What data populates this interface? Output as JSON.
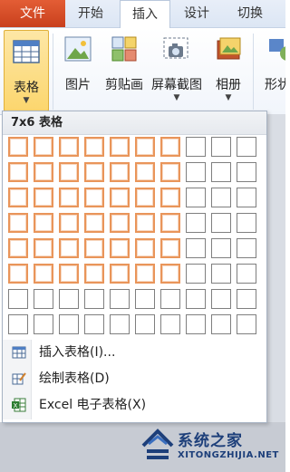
{
  "tabs": [
    {
      "label": "文件"
    },
    {
      "label": "开始"
    },
    {
      "label": "插入"
    },
    {
      "label": "设计"
    },
    {
      "label": "切换"
    }
  ],
  "ribbon": {
    "buttons": [
      {
        "label": "表格",
        "icon": "table-icon"
      },
      {
        "label": "图片",
        "icon": "picture-icon"
      },
      {
        "label": "剪贴画",
        "icon": "clipart-icon"
      },
      {
        "label": "屏幕截图",
        "icon": "screenshot-icon"
      },
      {
        "label": "相册",
        "icon": "photo-album-icon"
      },
      {
        "label": "形状",
        "icon": "shapes-icon"
      }
    ]
  },
  "panel": {
    "title": "7x6 表格",
    "grid": {
      "columns": 10,
      "rows": 8,
      "selected_columns": 7,
      "selected_rows": 6
    }
  },
  "menu": [
    {
      "label": "插入表格(I)...",
      "icon": "insert-table-icon"
    },
    {
      "label": "绘制表格(D)",
      "icon": "draw-table-icon"
    },
    {
      "label": "Excel 电子表格(X)",
      "icon": "excel-icon"
    }
  ],
  "watermark": {
    "text": "系统之家",
    "subtext": "XITONGZHIJIA.NET"
  },
  "colors": {
    "file_tab": "#d24726",
    "active_button": "#fcd66e",
    "selected_cell_border": "#e9955a"
  }
}
